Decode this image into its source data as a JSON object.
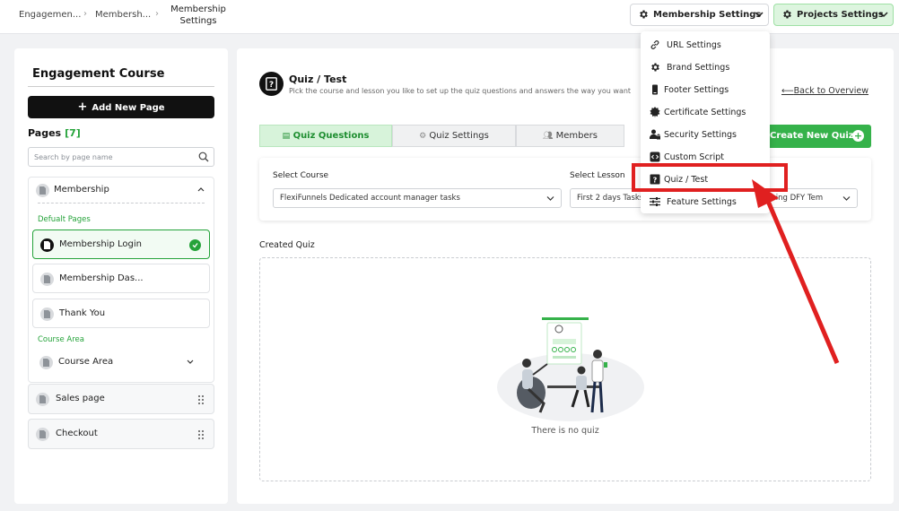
{
  "breadcrumb": {
    "items": [
      "Engagemen...",
      "Membersh..."
    ],
    "current_line1": "Membership",
    "current_line2": "Settings"
  },
  "header": {
    "membership_settings": "Membership Settings",
    "projects_settings": "Projects Settings"
  },
  "dropdown": {
    "items": [
      {
        "label": "URL Settings",
        "icon": "link-icon"
      },
      {
        "label": "Brand Settings",
        "icon": "gear-icon"
      },
      {
        "label": "Footer Settings",
        "icon": "phone-icon"
      },
      {
        "label": "Certificate Settings",
        "icon": "certificate-icon"
      },
      {
        "label": "Security Settings",
        "icon": "user-lock-icon"
      },
      {
        "label": "Custom Script",
        "icon": "code-icon"
      },
      {
        "label": "Quiz / Test",
        "icon": "quiz-icon"
      },
      {
        "label": "Feature Settings",
        "icon": "sliders-icon"
      }
    ],
    "highlighted": "Quiz / Test"
  },
  "sidebar": {
    "title": "Engagement Course",
    "add_page": "Add New Page",
    "pages_label": "Pages",
    "pages_count": "[7]",
    "search_placeholder": "Search by page name",
    "group": {
      "name": "Membership",
      "default_section": "Defualt Pages",
      "pages": [
        "Membership Login",
        "Membership Das...",
        "Thank You"
      ],
      "active_page": "Membership Login",
      "course_section": "Course Area",
      "course_item": "Course Area"
    },
    "other_items": [
      "Sales page",
      "Checkout"
    ]
  },
  "main": {
    "title": "Quiz / Test",
    "subtitle": "Pick the course and lesson you like to set up the quiz questions and answers the way you want",
    "back_link": "Back to Overview",
    "tabs": [
      "Quiz Questions",
      "Quiz Settings",
      "Members"
    ],
    "active_tab": "Quiz Questions",
    "create_button": "Create New Quiz",
    "select_course_label": "Select Course",
    "select_course_value": "FlexiFunnels Dedicated account manager tasks",
    "select_lesson_label": "Select Lesson",
    "select_lesson_value": "First 2 days Tasks",
    "third_select_value": "e using DFY Tem",
    "created_label": "Created Quiz",
    "empty_text": "There is no quiz"
  },
  "colors": {
    "accent_green": "#35b24a",
    "annotation_red": "#e02020",
    "tab_active_bg": "#d7f3da"
  }
}
